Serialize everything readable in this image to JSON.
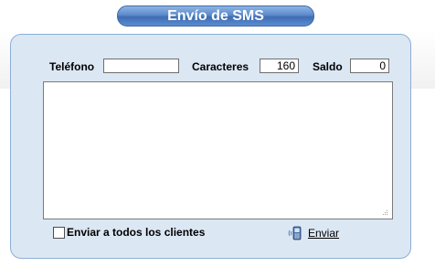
{
  "title": "Envío de SMS",
  "fields": {
    "telefono_label": "Teléfono",
    "telefono_value": "",
    "caracteres_label": "Caracteres",
    "caracteres_value": "160",
    "saldo_label": "Saldo",
    "saldo_value": "0"
  },
  "message": {
    "value": ""
  },
  "footer": {
    "checkbox_label": "Enviar a todos los clientes",
    "checkbox_checked": false,
    "send_label": "Enviar",
    "send_icon": "mobile-phone-icon"
  },
  "colors": {
    "panel_bg": "#dce7f4",
    "panel_border": "#8daed6",
    "title_blue": "#4f7fc2"
  }
}
